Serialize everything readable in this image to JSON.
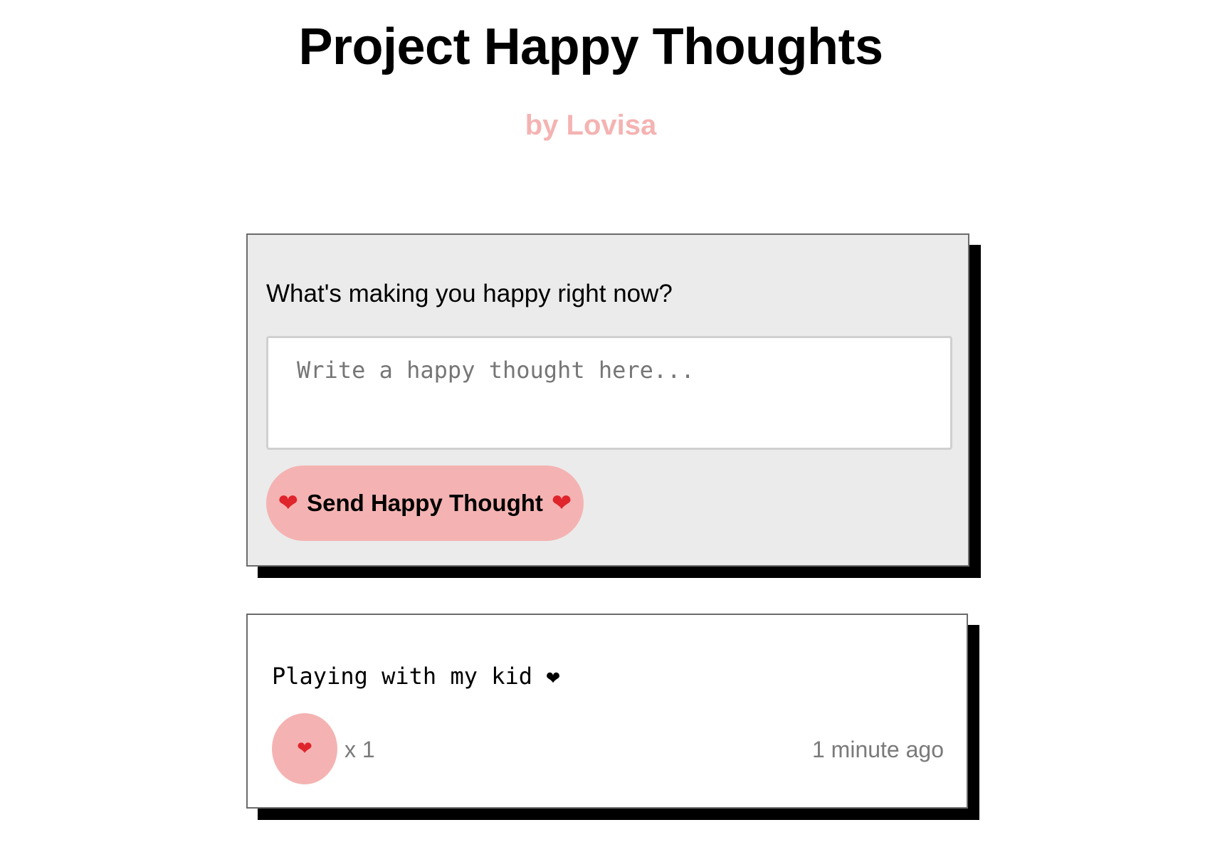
{
  "header": {
    "title": "Project Happy Thoughts",
    "byline": "by Lovisa"
  },
  "form": {
    "label": "What's making you happy right now?",
    "input_placeholder": "Write a happy thought here...",
    "input_value": "",
    "submit_label": "Send Happy Thought",
    "submit_icon": "heart-icon"
  },
  "thoughts": [
    {
      "message": "Playing with my kid ❤",
      "like_icon": "heart-icon",
      "likes_text": "x 1",
      "likes": 1,
      "time": "1 minute ago"
    }
  ],
  "colors": {
    "accent_pink": "#f4b3b2",
    "form_background": "#ebebeb",
    "card_shadow": "#000000",
    "heart_red": "#e0242c",
    "muted_text": "#7a7a7a"
  }
}
